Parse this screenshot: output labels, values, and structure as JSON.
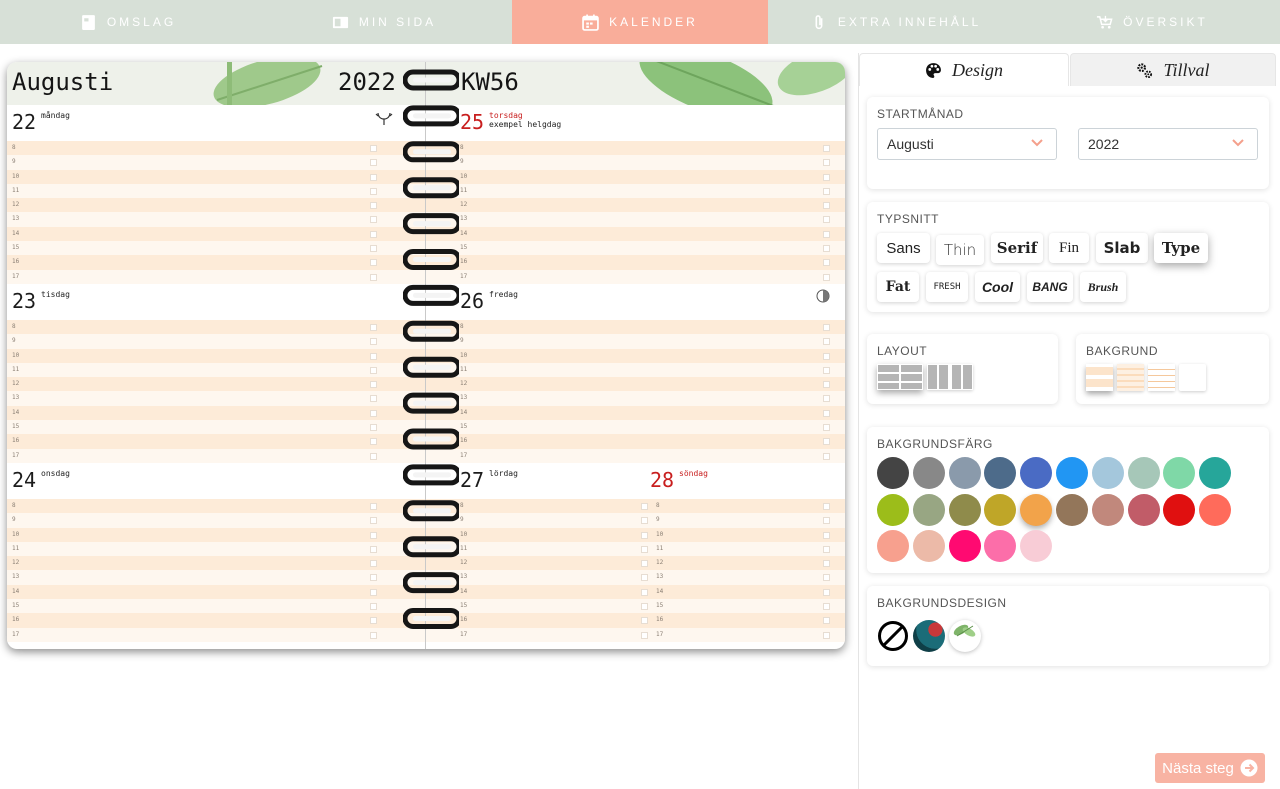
{
  "nav": {
    "tabs": [
      {
        "label": "Omslag",
        "icon": "cover-icon",
        "active": false
      },
      {
        "label": "Min sida",
        "icon": "page-icon",
        "active": false
      },
      {
        "label": "Kalender",
        "icon": "calendar-icon",
        "active": true
      },
      {
        "label": "Extra innehåll",
        "icon": "paperclip-icon",
        "active": false
      },
      {
        "label": "Översikt",
        "icon": "cart-icon",
        "active": false
      }
    ]
  },
  "planner": {
    "month": "Augusti",
    "year": "2022",
    "week": "KW56",
    "hours": [
      "8",
      "9",
      "10",
      "11",
      "12",
      "13",
      "14",
      "15",
      "16",
      "17"
    ],
    "days": {
      "mon": {
        "num": "22",
        "name": "måndag",
        "icon": "antlers-icon"
      },
      "thu": {
        "num": "25",
        "name": "torsdag",
        "note": "exempel helgdag",
        "red": true
      },
      "tue": {
        "num": "23",
        "name": "tisdag"
      },
      "fri": {
        "num": "26",
        "name": "fredag",
        "icon": "moon-phase-icon"
      },
      "wed": {
        "num": "24",
        "name": "onsdag"
      },
      "sat": {
        "num": "27",
        "name": "lördag"
      },
      "sun": {
        "num": "28",
        "name": "söndag",
        "red": true
      }
    }
  },
  "panel": {
    "tabs": {
      "design": "Design",
      "options": "Tillval"
    },
    "startmonth": {
      "label": "Startmånad",
      "month": "Augusti",
      "year": "2022"
    },
    "font": {
      "label": "Typsnitt",
      "options": [
        "Sans",
        "Thin",
        "Serif",
        "Fin",
        "Slab",
        "Type",
        "Fat",
        "FRESH",
        "Cool",
        "BANG",
        "Brush"
      ],
      "selected": "Type"
    },
    "layout": {
      "label": "Layout"
    },
    "background": {
      "label": "Bakgrund"
    },
    "bgcolor": {
      "label": "Bakgrundsfärg",
      "colors": [
        "#444444",
        "#888888",
        "#8a9aab",
        "#4d6b8a",
        "#4a6bc4",
        "#2196f3",
        "#a4c7dc",
        "#a6c7b8",
        "#7fd8a7",
        "#26a69a",
        "#9cbd1a",
        "#98a683",
        "#8f8b4b",
        "#bfa628",
        "#f2a34a",
        "#93765a",
        "#c1887c",
        "#c15c68",
        "#e01010",
        "#ff6b5b",
        "#f7a08e",
        "#ecbaa8",
        "#ff0a71",
        "#fc6ea9",
        "#f8ccd6"
      ],
      "selected": "#f2a34a"
    },
    "bgdesign": {
      "label": "Bakgrundsdesign"
    }
  },
  "next_label": "Nästa steg"
}
